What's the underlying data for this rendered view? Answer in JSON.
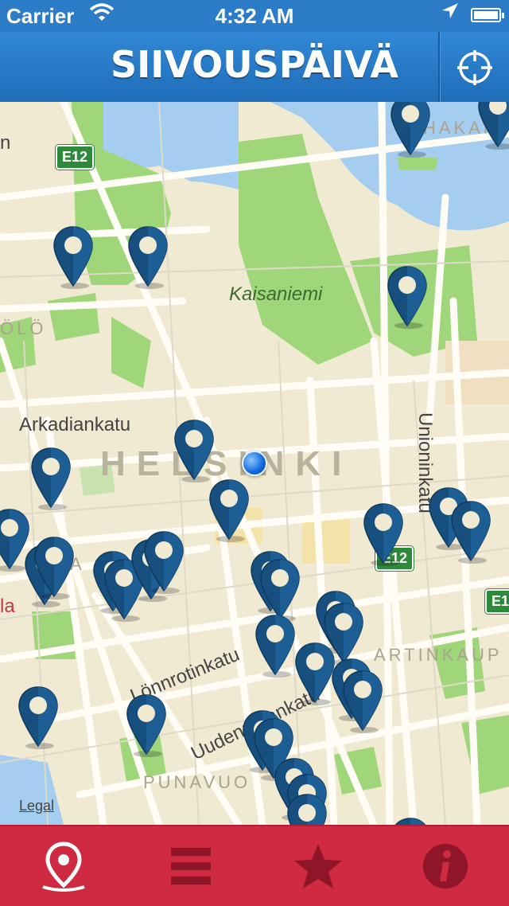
{
  "status": {
    "carrier": "Carrier",
    "time": "4:32 AM",
    "wifi_icon": "wifi-icon",
    "location_icon": "location-arrow-icon",
    "battery_icon": "battery-icon"
  },
  "header": {
    "logo_text": "SIIVOUSPÄIVÄ",
    "locate_icon": "crosshair-icon"
  },
  "map": {
    "labels": {
      "kaisaniemi": "Kaisaniemi",
      "arkadiankatu": "Arkadiankatu",
      "helsinki": "HELSINKI",
      "unioninkatu": "Unioninkatu",
      "lonnrotinkatu": "Lönnrotinkatu",
      "uudenmaankatu": "Uudenmaankatu",
      "punavuori": "PUNAVUO",
      "toolo": "ÖLÖ",
      "hakaniemi": "HAKAN",
      "kruununhaka": "ARTINKAUP",
      "la": "la",
      "n": "n",
      "a": "A"
    },
    "road_badges": {
      "e12_top": "E12",
      "e12_mid": "E12",
      "e1_right": "E1"
    },
    "legal": "Legal",
    "pin_icon": "map-pin-icon",
    "user_location_icon": "user-location-icon"
  },
  "tabbar": {
    "tabs": [
      {
        "icon": "map-marker-icon",
        "active": true
      },
      {
        "icon": "list-icon",
        "active": false
      },
      {
        "icon": "star-icon",
        "active": false
      },
      {
        "icon": "info-icon",
        "active": false
      }
    ]
  },
  "colors": {
    "header_blue": "#2c7cc8",
    "pin_blue": "#17507f",
    "tab_red": "#cf2a42",
    "park_green": "#9fd67a",
    "water_blue": "#a4cdf0",
    "land": "#f1ead2"
  }
}
